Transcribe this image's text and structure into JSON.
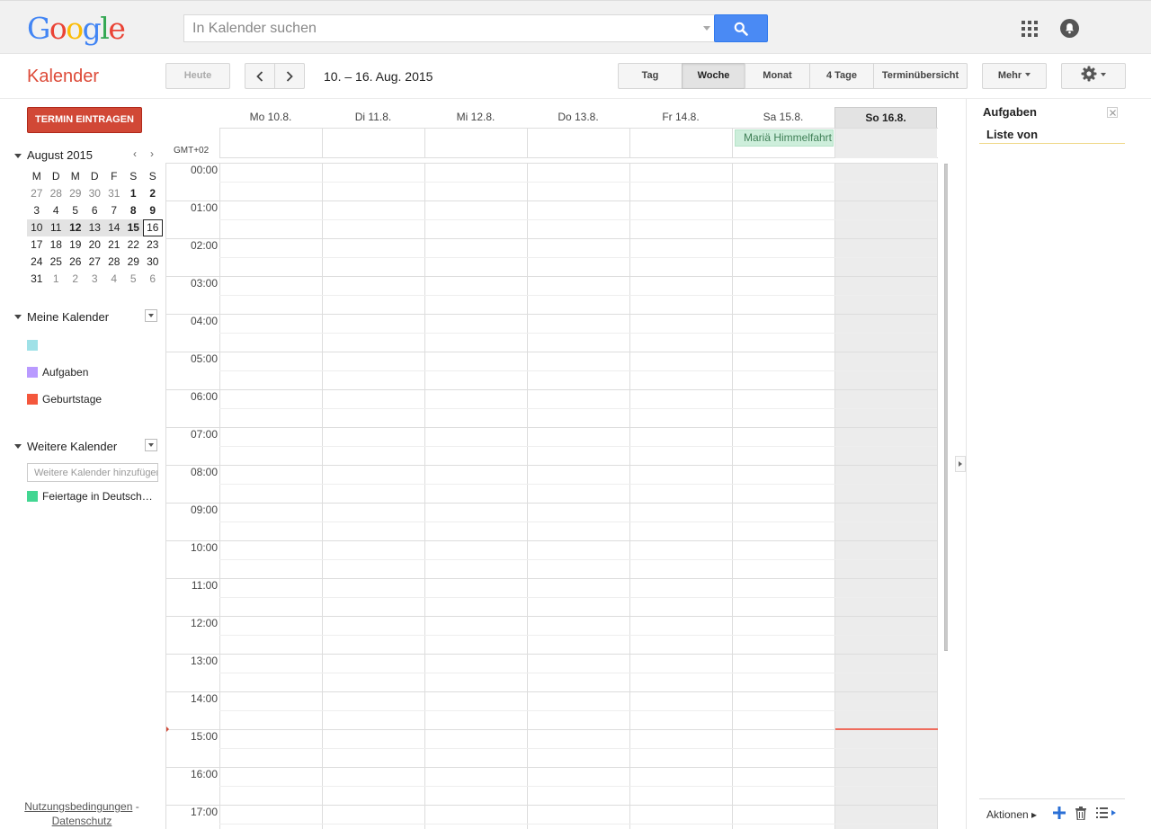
{
  "header": {
    "logo_letters": [
      {
        "ch": "G",
        "color": "#4285f4"
      },
      {
        "ch": "o",
        "color": "#ea4335"
      },
      {
        "ch": "o",
        "color": "#fbbc05"
      },
      {
        "ch": "g",
        "color": "#4285f4"
      },
      {
        "ch": "l",
        "color": "#34a853"
      },
      {
        "ch": "e",
        "color": "#ea4335"
      }
    ],
    "search_placeholder": "In Kalender suchen"
  },
  "toolbar": {
    "app_title": "Kalender",
    "today_label": "Heute",
    "date_range": "10. – 16. Aug. 2015",
    "views": [
      "Tag",
      "Woche",
      "Monat",
      "4 Tage",
      "Terminübersicht"
    ],
    "active_view": "Woche",
    "more_label": "Mehr"
  },
  "sidebar": {
    "create_label": "TERMIN EINTRAGEN",
    "mini_calendar": {
      "title": "August 2015",
      "weekdays": [
        "M",
        "D",
        "M",
        "D",
        "F",
        "S",
        "S"
      ],
      "weeks": [
        [
          "27",
          "28",
          "29",
          "30",
          "31",
          "1",
          "2"
        ],
        [
          "3",
          "4",
          "5",
          "6",
          "7",
          "8",
          "9"
        ],
        [
          "10",
          "11",
          "12",
          "13",
          "14",
          "15",
          "16"
        ],
        [
          "17",
          "18",
          "19",
          "20",
          "21",
          "22",
          "23"
        ],
        [
          "24",
          "25",
          "26",
          "27",
          "28",
          "29",
          "30"
        ],
        [
          "31",
          "1",
          "2",
          "3",
          "4",
          "5",
          "6"
        ]
      ],
      "selected_week_index": 2,
      "today": "16"
    },
    "my_calendars_label": "Meine Kalender",
    "my_calendars": [
      {
        "label": "",
        "color": "#9fe1e7"
      },
      {
        "label": "Aufgaben",
        "color": "#b99aff"
      },
      {
        "label": "Geburtstage",
        "color": "#f4573c"
      }
    ],
    "other_calendars_label": "Weitere Kalender",
    "add_calendar_placeholder": "Weitere Kalender hinzufügen",
    "other_calendars": [
      {
        "label": "Feiertage in Deutsch…",
        "color": "#42d692"
      }
    ],
    "footer_terms": "Nutzungsbedingungen",
    "footer_separator": " - ",
    "footer_privacy": "Datenschutz"
  },
  "grid": {
    "timezone_label": "GMT+02",
    "days": [
      "Mo 10.8.",
      "Di 11.8.",
      "Mi 12.8.",
      "Do 13.8.",
      "Fr 14.8.",
      "Sa 15.8.",
      "So 16.8."
    ],
    "selected_day_index": 6,
    "hours": [
      "00:00",
      "01:00",
      "02:00",
      "03:00",
      "04:00",
      "05:00",
      "06:00",
      "07:00",
      "08:00",
      "09:00",
      "10:00",
      "11:00",
      "12:00",
      "13:00",
      "14:00",
      "15:00",
      "16:00",
      "17:00"
    ],
    "all_day_event": {
      "title": "Mariä Himmelfahrt",
      "day_index": 5
    },
    "current_time": "14:58"
  },
  "tasks": {
    "title": "Aufgaben",
    "list_name": "Liste von",
    "actions_label": "Aktionen ▸"
  }
}
